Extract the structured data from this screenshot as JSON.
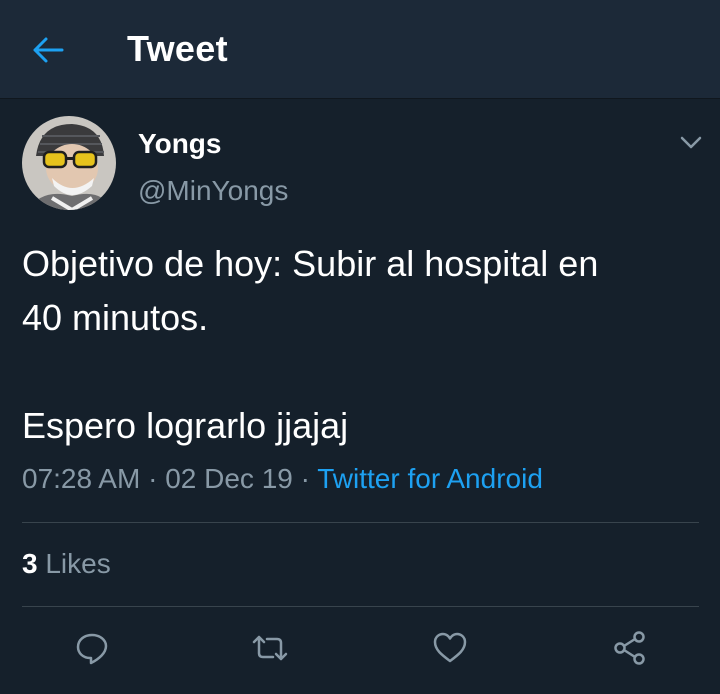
{
  "header": {
    "title": "Tweet",
    "back_icon": "back-arrow-icon"
  },
  "tweet": {
    "author": {
      "display_name": "Yongs",
      "handle": "@MinYongs"
    },
    "text_lines": [
      "Objetivo de hoy: Subir al hospital en",
      "40 minutos.",
      "Espero lograrlo jjajaj"
    ],
    "time": "07:28 AM",
    "date": "02 Dec 19",
    "separator": "·",
    "source": "Twitter for Android",
    "likes_count": "3",
    "likes_label": "Likes"
  },
  "actions": [
    "reply-icon",
    "retweet-icon",
    "like-icon",
    "share-icon"
  ],
  "colors": {
    "background": "#15202b",
    "header": "#1c2938",
    "accent": "#1da1f2",
    "secondary_text": "#8899a6",
    "divider": "#38444d"
  }
}
